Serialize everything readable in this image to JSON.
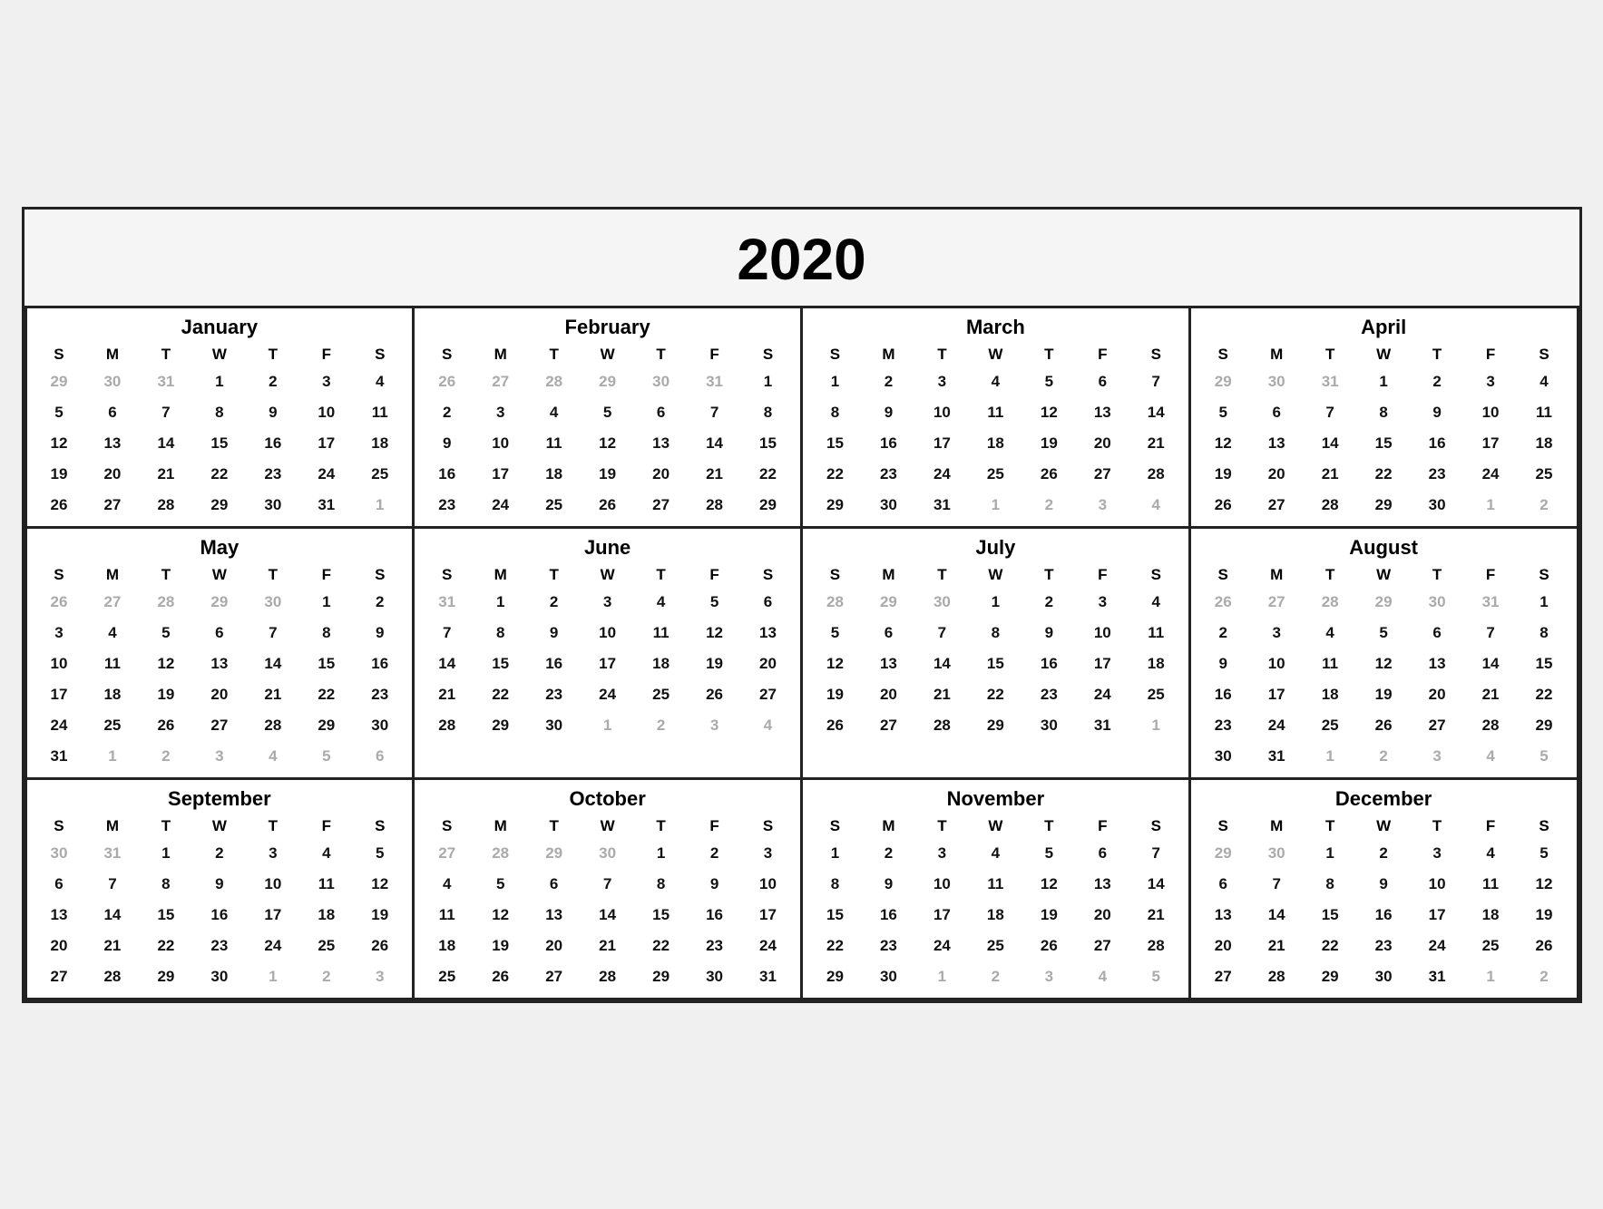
{
  "year": "2020",
  "months": [
    {
      "name": "January",
      "days": [
        {
          "d": "29",
          "o": true
        },
        {
          "d": "30",
          "o": true
        },
        {
          "d": "31",
          "o": true
        },
        {
          "d": "1"
        },
        {
          "d": "2"
        },
        {
          "d": "3"
        },
        {
          "d": "4"
        },
        {
          "d": "5"
        },
        {
          "d": "6"
        },
        {
          "d": "7"
        },
        {
          "d": "8"
        },
        {
          "d": "9"
        },
        {
          "d": "10"
        },
        {
          "d": "11"
        },
        {
          "d": "12"
        },
        {
          "d": "13"
        },
        {
          "d": "14"
        },
        {
          "d": "15"
        },
        {
          "d": "16"
        },
        {
          "d": "17"
        },
        {
          "d": "18"
        },
        {
          "d": "19"
        },
        {
          "d": "20"
        },
        {
          "d": "21"
        },
        {
          "d": "22"
        },
        {
          "d": "23"
        },
        {
          "d": "24"
        },
        {
          "d": "25"
        },
        {
          "d": "26"
        },
        {
          "d": "27"
        },
        {
          "d": "28"
        },
        {
          "d": "29"
        },
        {
          "d": "30"
        },
        {
          "d": "31"
        },
        {
          "d": "1",
          "o": true
        }
      ]
    },
    {
      "name": "February",
      "days": [
        {
          "d": "26",
          "o": true
        },
        {
          "d": "27",
          "o": true
        },
        {
          "d": "28",
          "o": true
        },
        {
          "d": "29",
          "o": true
        },
        {
          "d": "30",
          "o": true
        },
        {
          "d": "31",
          "o": true
        },
        {
          "d": "1"
        },
        {
          "d": "2"
        },
        {
          "d": "3"
        },
        {
          "d": "4"
        },
        {
          "d": "5"
        },
        {
          "d": "6"
        },
        {
          "d": "7"
        },
        {
          "d": "8"
        },
        {
          "d": "9"
        },
        {
          "d": "10"
        },
        {
          "d": "11"
        },
        {
          "d": "12"
        },
        {
          "d": "13"
        },
        {
          "d": "14"
        },
        {
          "d": "15"
        },
        {
          "d": "16"
        },
        {
          "d": "17"
        },
        {
          "d": "18"
        },
        {
          "d": "19"
        },
        {
          "d": "20"
        },
        {
          "d": "21"
        },
        {
          "d": "22"
        },
        {
          "d": "23"
        },
        {
          "d": "24"
        },
        {
          "d": "25"
        },
        {
          "d": "26"
        },
        {
          "d": "27"
        },
        {
          "d": "28"
        },
        {
          "d": "29"
        }
      ]
    },
    {
      "name": "March",
      "days": [
        {
          "d": "1"
        },
        {
          "d": "2"
        },
        {
          "d": "3"
        },
        {
          "d": "4"
        },
        {
          "d": "5"
        },
        {
          "d": "6"
        },
        {
          "d": "7"
        },
        {
          "d": "8"
        },
        {
          "d": "9"
        },
        {
          "d": "10"
        },
        {
          "d": "11"
        },
        {
          "d": "12"
        },
        {
          "d": "13"
        },
        {
          "d": "14"
        },
        {
          "d": "15"
        },
        {
          "d": "16"
        },
        {
          "d": "17"
        },
        {
          "d": "18"
        },
        {
          "d": "19"
        },
        {
          "d": "20"
        },
        {
          "d": "21"
        },
        {
          "d": "22"
        },
        {
          "d": "23"
        },
        {
          "d": "24"
        },
        {
          "d": "25"
        },
        {
          "d": "26"
        },
        {
          "d": "27"
        },
        {
          "d": "28"
        },
        {
          "d": "29"
        },
        {
          "d": "30"
        },
        {
          "d": "31"
        },
        {
          "d": "1",
          "o": true
        },
        {
          "d": "2",
          "o": true
        },
        {
          "d": "3",
          "o": true
        },
        {
          "d": "4",
          "o": true
        }
      ]
    },
    {
      "name": "April",
      "days": [
        {
          "d": "29",
          "o": true
        },
        {
          "d": "30",
          "o": true
        },
        {
          "d": "31",
          "o": true
        },
        {
          "d": "1"
        },
        {
          "d": "2"
        },
        {
          "d": "3"
        },
        {
          "d": "4"
        },
        {
          "d": "5"
        },
        {
          "d": "6"
        },
        {
          "d": "7"
        },
        {
          "d": "8"
        },
        {
          "d": "9"
        },
        {
          "d": "10"
        },
        {
          "d": "11"
        },
        {
          "d": "12"
        },
        {
          "d": "13"
        },
        {
          "d": "14"
        },
        {
          "d": "15"
        },
        {
          "d": "16"
        },
        {
          "d": "17"
        },
        {
          "d": "18"
        },
        {
          "d": "19"
        },
        {
          "d": "20"
        },
        {
          "d": "21"
        },
        {
          "d": "22"
        },
        {
          "d": "23"
        },
        {
          "d": "24"
        },
        {
          "d": "25"
        },
        {
          "d": "26"
        },
        {
          "d": "27"
        },
        {
          "d": "28"
        },
        {
          "d": "29"
        },
        {
          "d": "30"
        },
        {
          "d": "1",
          "o": true
        },
        {
          "d": "2",
          "o": true
        }
      ]
    },
    {
      "name": "May",
      "days": [
        {
          "d": "26",
          "o": true
        },
        {
          "d": "27",
          "o": true
        },
        {
          "d": "28",
          "o": true
        },
        {
          "d": "29",
          "o": true
        },
        {
          "d": "30",
          "o": true
        },
        {
          "d": "1"
        },
        {
          "d": "2"
        },
        {
          "d": "3"
        },
        {
          "d": "4"
        },
        {
          "d": "5"
        },
        {
          "d": "6"
        },
        {
          "d": "7"
        },
        {
          "d": "8"
        },
        {
          "d": "9"
        },
        {
          "d": "10"
        },
        {
          "d": "11"
        },
        {
          "d": "12"
        },
        {
          "d": "13"
        },
        {
          "d": "14"
        },
        {
          "d": "15"
        },
        {
          "d": "16"
        },
        {
          "d": "17"
        },
        {
          "d": "18"
        },
        {
          "d": "19"
        },
        {
          "d": "20"
        },
        {
          "d": "21"
        },
        {
          "d": "22"
        },
        {
          "d": "23"
        },
        {
          "d": "24"
        },
        {
          "d": "25"
        },
        {
          "d": "26"
        },
        {
          "d": "27"
        },
        {
          "d": "28"
        },
        {
          "d": "29"
        },
        {
          "d": "30"
        },
        {
          "d": "31"
        },
        {
          "d": "1",
          "o": true
        },
        {
          "d": "2",
          "o": true
        },
        {
          "d": "3",
          "o": true
        },
        {
          "d": "4",
          "o": true
        },
        {
          "d": "5",
          "o": true
        },
        {
          "d": "6",
          "o": true
        }
      ]
    },
    {
      "name": "June",
      "days": [
        {
          "d": "31",
          "o": true
        },
        {
          "d": "1"
        },
        {
          "d": "2"
        },
        {
          "d": "3"
        },
        {
          "d": "4"
        },
        {
          "d": "5"
        },
        {
          "d": "6"
        },
        {
          "d": "7"
        },
        {
          "d": "8"
        },
        {
          "d": "9"
        },
        {
          "d": "10"
        },
        {
          "d": "11"
        },
        {
          "d": "12"
        },
        {
          "d": "13"
        },
        {
          "d": "14"
        },
        {
          "d": "15"
        },
        {
          "d": "16"
        },
        {
          "d": "17"
        },
        {
          "d": "18"
        },
        {
          "d": "19"
        },
        {
          "d": "20"
        },
        {
          "d": "21"
        },
        {
          "d": "22"
        },
        {
          "d": "23"
        },
        {
          "d": "24"
        },
        {
          "d": "25"
        },
        {
          "d": "26"
        },
        {
          "d": "27"
        },
        {
          "d": "28"
        },
        {
          "d": "29"
        },
        {
          "d": "30"
        },
        {
          "d": "1",
          "o": true
        },
        {
          "d": "2",
          "o": true
        },
        {
          "d": "3",
          "o": true
        },
        {
          "d": "4",
          "o": true
        }
      ]
    },
    {
      "name": "July",
      "days": [
        {
          "d": "28",
          "o": true
        },
        {
          "d": "29",
          "o": true
        },
        {
          "d": "30",
          "o": true
        },
        {
          "d": "1"
        },
        {
          "d": "2"
        },
        {
          "d": "3"
        },
        {
          "d": "4"
        },
        {
          "d": "5"
        },
        {
          "d": "6"
        },
        {
          "d": "7"
        },
        {
          "d": "8"
        },
        {
          "d": "9"
        },
        {
          "d": "10"
        },
        {
          "d": "11"
        },
        {
          "d": "12"
        },
        {
          "d": "13"
        },
        {
          "d": "14"
        },
        {
          "d": "15"
        },
        {
          "d": "16"
        },
        {
          "d": "17"
        },
        {
          "d": "18"
        },
        {
          "d": "19"
        },
        {
          "d": "20"
        },
        {
          "d": "21"
        },
        {
          "d": "22"
        },
        {
          "d": "23"
        },
        {
          "d": "24"
        },
        {
          "d": "25"
        },
        {
          "d": "26"
        },
        {
          "d": "27"
        },
        {
          "d": "28"
        },
        {
          "d": "29"
        },
        {
          "d": "30"
        },
        {
          "d": "31"
        },
        {
          "d": "1",
          "o": true
        }
      ]
    },
    {
      "name": "August",
      "days": [
        {
          "d": "26",
          "o": true
        },
        {
          "d": "27",
          "o": true
        },
        {
          "d": "28",
          "o": true
        },
        {
          "d": "29",
          "o": true
        },
        {
          "d": "30",
          "o": true
        },
        {
          "d": "31",
          "o": true
        },
        {
          "d": "1"
        },
        {
          "d": "2"
        },
        {
          "d": "3"
        },
        {
          "d": "4"
        },
        {
          "d": "5"
        },
        {
          "d": "6"
        },
        {
          "d": "7"
        },
        {
          "d": "8"
        },
        {
          "d": "9"
        },
        {
          "d": "10"
        },
        {
          "d": "11"
        },
        {
          "d": "12"
        },
        {
          "d": "13"
        },
        {
          "d": "14"
        },
        {
          "d": "15"
        },
        {
          "d": "16"
        },
        {
          "d": "17"
        },
        {
          "d": "18"
        },
        {
          "d": "19"
        },
        {
          "d": "20"
        },
        {
          "d": "21"
        },
        {
          "d": "22"
        },
        {
          "d": "23"
        },
        {
          "d": "24"
        },
        {
          "d": "25"
        },
        {
          "d": "26"
        },
        {
          "d": "27"
        },
        {
          "d": "28"
        },
        {
          "d": "29"
        },
        {
          "d": "30"
        },
        {
          "d": "31"
        },
        {
          "d": "1",
          "o": true
        },
        {
          "d": "2",
          "o": true
        },
        {
          "d": "3",
          "o": true
        },
        {
          "d": "4",
          "o": true
        },
        {
          "d": "5",
          "o": true
        }
      ]
    },
    {
      "name": "September",
      "days": [
        {
          "d": "30",
          "o": true
        },
        {
          "d": "31",
          "o": true
        },
        {
          "d": "1"
        },
        {
          "d": "2"
        },
        {
          "d": "3"
        },
        {
          "d": "4"
        },
        {
          "d": "5"
        },
        {
          "d": "6"
        },
        {
          "d": "7"
        },
        {
          "d": "8"
        },
        {
          "d": "9"
        },
        {
          "d": "10"
        },
        {
          "d": "11"
        },
        {
          "d": "12"
        },
        {
          "d": "13"
        },
        {
          "d": "14"
        },
        {
          "d": "15"
        },
        {
          "d": "16"
        },
        {
          "d": "17"
        },
        {
          "d": "18"
        },
        {
          "d": "19"
        },
        {
          "d": "20"
        },
        {
          "d": "21"
        },
        {
          "d": "22"
        },
        {
          "d": "23"
        },
        {
          "d": "24"
        },
        {
          "d": "25"
        },
        {
          "d": "26"
        },
        {
          "d": "27"
        },
        {
          "d": "28"
        },
        {
          "d": "29"
        },
        {
          "d": "30"
        },
        {
          "d": "1",
          "o": true
        },
        {
          "d": "2",
          "o": true
        },
        {
          "d": "3",
          "o": true
        }
      ]
    },
    {
      "name": "October",
      "days": [
        {
          "d": "27",
          "o": true
        },
        {
          "d": "28",
          "o": true
        },
        {
          "d": "29",
          "o": true
        },
        {
          "d": "30",
          "o": true
        },
        {
          "d": "1"
        },
        {
          "d": "2"
        },
        {
          "d": "3"
        },
        {
          "d": "4"
        },
        {
          "d": "5"
        },
        {
          "d": "6"
        },
        {
          "d": "7"
        },
        {
          "d": "8"
        },
        {
          "d": "9"
        },
        {
          "d": "10"
        },
        {
          "d": "11"
        },
        {
          "d": "12"
        },
        {
          "d": "13"
        },
        {
          "d": "14"
        },
        {
          "d": "15"
        },
        {
          "d": "16"
        },
        {
          "d": "17"
        },
        {
          "d": "18"
        },
        {
          "d": "19"
        },
        {
          "d": "20"
        },
        {
          "d": "21"
        },
        {
          "d": "22"
        },
        {
          "d": "23"
        },
        {
          "d": "24"
        },
        {
          "d": "25"
        },
        {
          "d": "26"
        },
        {
          "d": "27"
        },
        {
          "d": "28"
        },
        {
          "d": "29"
        },
        {
          "d": "30"
        },
        {
          "d": "31"
        }
      ]
    },
    {
      "name": "November",
      "days": [
        {
          "d": "1"
        },
        {
          "d": "2"
        },
        {
          "d": "3"
        },
        {
          "d": "4"
        },
        {
          "d": "5"
        },
        {
          "d": "6"
        },
        {
          "d": "7"
        },
        {
          "d": "8"
        },
        {
          "d": "9"
        },
        {
          "d": "10"
        },
        {
          "d": "11"
        },
        {
          "d": "12"
        },
        {
          "d": "13"
        },
        {
          "d": "14"
        },
        {
          "d": "15"
        },
        {
          "d": "16"
        },
        {
          "d": "17"
        },
        {
          "d": "18"
        },
        {
          "d": "19"
        },
        {
          "d": "20"
        },
        {
          "d": "21"
        },
        {
          "d": "22"
        },
        {
          "d": "23"
        },
        {
          "d": "24"
        },
        {
          "d": "25"
        },
        {
          "d": "26"
        },
        {
          "d": "27"
        },
        {
          "d": "28"
        },
        {
          "d": "29"
        },
        {
          "d": "30"
        },
        {
          "d": "1",
          "o": true
        },
        {
          "d": "2",
          "o": true
        },
        {
          "d": "3",
          "o": true
        },
        {
          "d": "4",
          "o": true
        },
        {
          "d": "5",
          "o": true
        }
      ]
    },
    {
      "name": "December",
      "days": [
        {
          "d": "29",
          "o": true
        },
        {
          "d": "30",
          "o": true
        },
        {
          "d": "1"
        },
        {
          "d": "2"
        },
        {
          "d": "3"
        },
        {
          "d": "4"
        },
        {
          "d": "5"
        },
        {
          "d": "6"
        },
        {
          "d": "7"
        },
        {
          "d": "8"
        },
        {
          "d": "9"
        },
        {
          "d": "10"
        },
        {
          "d": "11"
        },
        {
          "d": "12"
        },
        {
          "d": "13"
        },
        {
          "d": "14"
        },
        {
          "d": "15"
        },
        {
          "d": "16"
        },
        {
          "d": "17"
        },
        {
          "d": "18"
        },
        {
          "d": "19"
        },
        {
          "d": "20"
        },
        {
          "d": "21"
        },
        {
          "d": "22"
        },
        {
          "d": "23"
        },
        {
          "d": "24"
        },
        {
          "d": "25"
        },
        {
          "d": "26"
        },
        {
          "d": "27"
        },
        {
          "d": "28"
        },
        {
          "d": "29"
        },
        {
          "d": "30"
        },
        {
          "d": "31"
        },
        {
          "d": "1",
          "o": true
        },
        {
          "d": "2",
          "o": true
        }
      ]
    }
  ],
  "day_headers": [
    "S",
    "M",
    "T",
    "W",
    "T",
    "F",
    "S"
  ]
}
